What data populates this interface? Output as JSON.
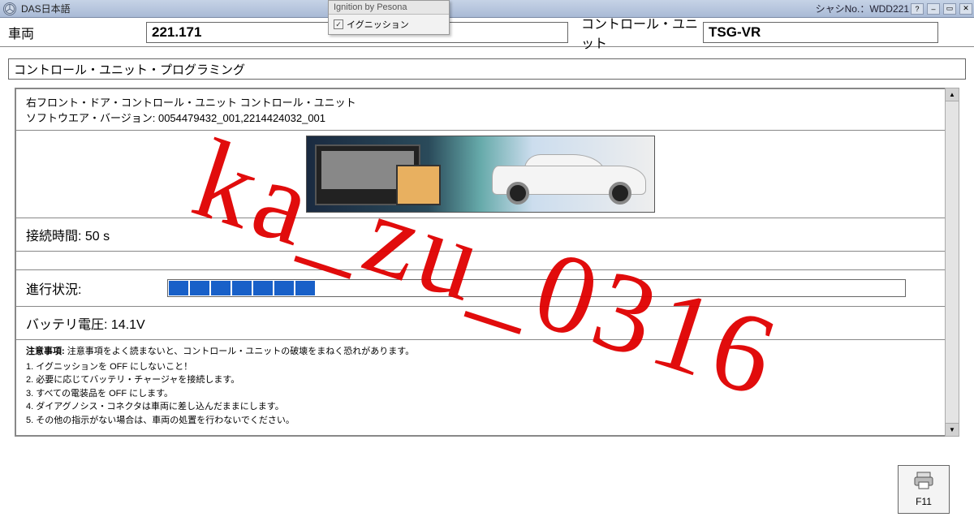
{
  "titlebar": {
    "app_title": "DAS日本語",
    "chassis_label": "シャシNo.：WDD221"
  },
  "dropdown": {
    "header": "Ignition by Pesona",
    "item": "イグニッション",
    "checked": true
  },
  "header": {
    "vehicle_label": "車両",
    "vehicle_value": "221.171",
    "cu_label": "コントロール・ユニット",
    "cu_value": "TSG-VR"
  },
  "section_title": "コントロール・ユニット・プログラミング",
  "unit": {
    "name": "右フロント・ドア・コントロール・ユニット コントロール・ユニット",
    "sw_label": "ソフトウエア・バージョン: ",
    "sw_value": "0054479432_001,2214424032_001"
  },
  "connection": {
    "label": "接続時間: ",
    "value": "50 s"
  },
  "progress": {
    "label": "進行状況:",
    "segments": 7
  },
  "battery": {
    "label": "バッテリ電圧: ",
    "value": "14.1V"
  },
  "notes": {
    "title": "注意事項: ",
    "title_text": "注意事項をよく読まないと、コントロール・ユニットの破壊をまねく恐れがあります。",
    "items": [
      "1. イグニッションを OFF にしないこと！",
      "2. 必要に応じてバッテリ・チャージャを接続します。",
      "3. すべての電装品を OFF にします。",
      "4. ダイアグノシス・コネクタは車両に差し込んだままにします。",
      "5. その他の指示がない場合は、車両の処置を行わないでください。"
    ]
  },
  "footer": {
    "f11": "F11"
  },
  "watermark": "ka_zu_0316"
}
